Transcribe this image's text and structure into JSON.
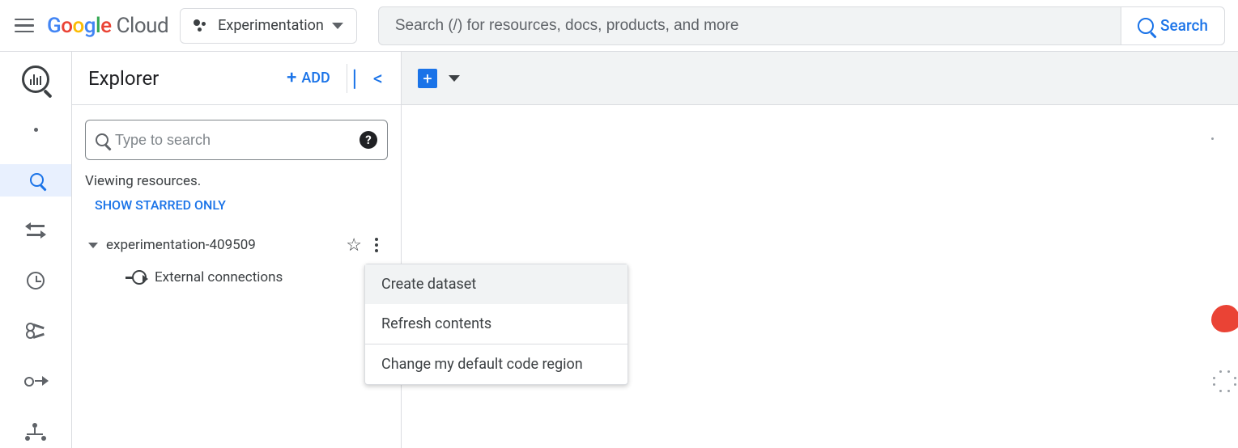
{
  "header": {
    "brand_google": "Google",
    "brand_cloud": "Cloud",
    "project_name": "Experimentation",
    "search_placeholder": "Search (/) for resources, docs, products, and more",
    "search_button": "Search"
  },
  "explorer": {
    "title": "Explorer",
    "add_label": "ADD",
    "search_placeholder": "Type to search",
    "viewing_text": "Viewing resources.",
    "starred_link": "SHOW STARRED ONLY",
    "tree": {
      "project": "experimentation-409509",
      "external": "External connections"
    }
  },
  "context_menu": {
    "items": [
      "Create dataset",
      "Refresh contents",
      "Change my default code region"
    ]
  },
  "rail_icons": [
    "bigquery",
    "dot",
    "search",
    "transfer",
    "scheduled",
    "scissors",
    "pipeline",
    "flow"
  ]
}
